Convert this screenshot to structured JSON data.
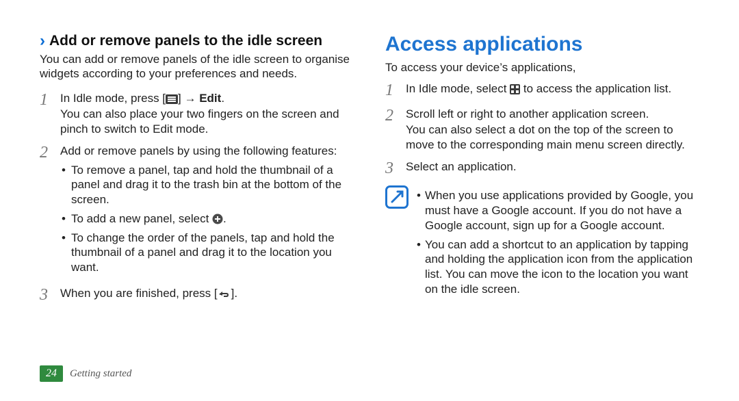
{
  "left": {
    "heading": "Add or remove panels to the idle screen",
    "intro": "You can add or remove panels of the idle screen to organise widgets according to your preferences and needs.",
    "steps": [
      {
        "num": "1",
        "line": "In Idle mode, press [",
        "post_icon": "] → ",
        "bold": "Edit",
        "tail": ".",
        "then": "You can also place your two fingers on the screen and pinch to switch to Edit mode."
      },
      {
        "num": "2",
        "line": "Add or remove panels by using the following features:",
        "bullets": [
          "To remove a panel, tap and hold the thumbnail of a panel and drag it to the trash bin at the bottom of the screen.",
          {
            "pre": "To add a new panel, select ",
            "post": "."
          },
          "To change the order of the panels, tap and hold the thumbnail of a panel and drag it to the location you want."
        ]
      },
      {
        "num": "3",
        "line": "When you are finished, press [",
        "post_icon": "]."
      }
    ]
  },
  "right": {
    "heading": "Access applications",
    "intro": "To access your device’s applications,",
    "steps": [
      {
        "num": "1",
        "line": "In Idle mode, select ",
        "tail": " to access the application list."
      },
      {
        "num": "2",
        "line": "Scroll left or right to another application screen.",
        "then": "You can also select a dot on the top of the screen to move to the corresponding main menu screen directly."
      },
      {
        "num": "3",
        "line": "Select an application."
      }
    ],
    "note": [
      "When you use applications provided by Google, you must have a Google account. If you do not have a Google account, sign up for a Google account.",
      "You can add a shortcut to an application by tapping and holding the application icon from the application list. You can move the icon to the location you want on the idle screen."
    ]
  },
  "footer": {
    "page": "24",
    "section": "Getting started"
  }
}
